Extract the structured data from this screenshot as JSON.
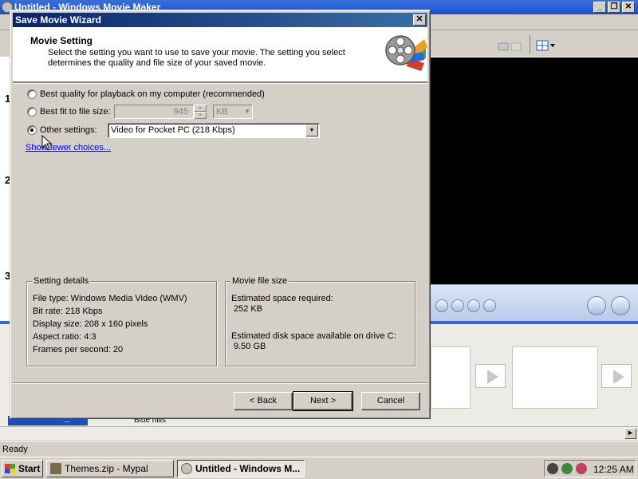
{
  "app": {
    "window_title": "Untitled - Windows Movie Maker",
    "left_step_numbers": [
      "1",
      "2",
      "3"
    ],
    "storyboard_fragment_text": "Blue hills",
    "clip_label_fragment": "...",
    "status_text": "Ready"
  },
  "dialog": {
    "title": "Save Movie Wizard",
    "close_glyph": "✕",
    "header": {
      "title": "Movie Setting",
      "description": "Select the setting you want to use to save your movie. The setting you select determines the quality and file size of your saved movie."
    },
    "options": {
      "best_quality_label": "Best quality for playback on my computer (recommended)",
      "best_fit_label": "Best fit to file size:",
      "best_fit_value": "945",
      "best_fit_unit": "KB",
      "other_settings_label": "Other settings:",
      "other_settings_value": "Video for Pocket PC (218 Kbps)",
      "selected": "other_settings"
    },
    "show_fewer_link": "Show fewer choices...",
    "setting_details": {
      "legend": "Setting details",
      "lines": [
        "File type: Windows Media Video (WMV)",
        "Bit rate: 218 Kbps",
        "Display size: 208 x 160 pixels",
        "Aspect ratio: 4:3",
        "Frames per second: 20"
      ]
    },
    "movie_file_size": {
      "legend": "Movie file size",
      "space_required_label": "Estimated space required:",
      "space_required_value": "252 KB",
      "disk_space_label": "Estimated disk space available on drive C:",
      "disk_space_value": "9.50 GB"
    },
    "buttons": {
      "back": "< Back",
      "next": "Next >",
      "cancel": "Cancel"
    }
  },
  "taskbar": {
    "start_label": "Start",
    "tasks": [
      {
        "label": "Themes.zip - Mypal",
        "active": false
      },
      {
        "label": "Untitled - Windows M...",
        "active": true
      }
    ],
    "clock": "12:25 AM"
  },
  "colors": {
    "dialog_titlebar": "#0a246a",
    "xp_titlebar": "#245edb",
    "link": "#0000ee",
    "storyboard_separator": "#3168d5"
  }
}
